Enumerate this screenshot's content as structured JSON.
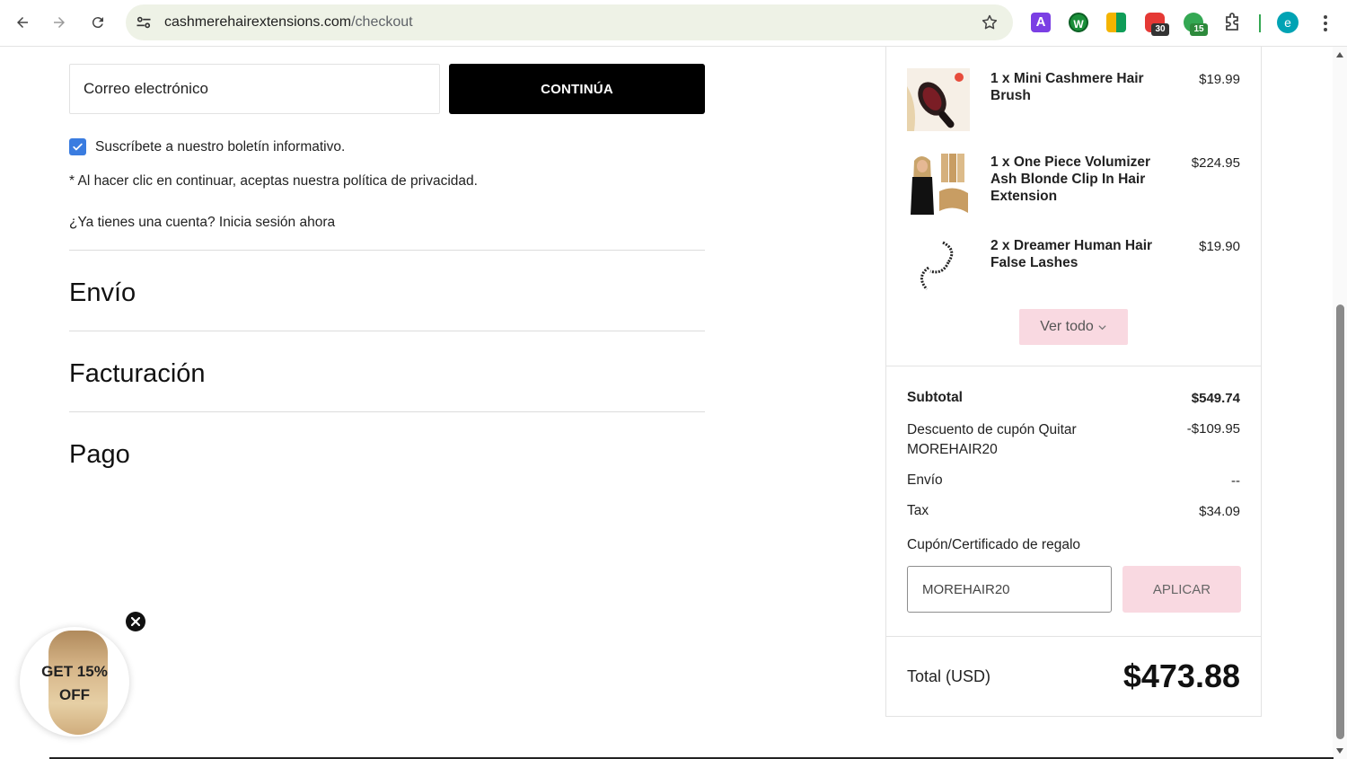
{
  "browser": {
    "url_domain": "cashmerehairextensions.com",
    "url_path": "/checkout",
    "extensions": [
      {
        "name": "text-a-extension-icon",
        "label": "A"
      },
      {
        "name": "w-extension-icon",
        "label": "W"
      },
      {
        "name": "grid-extension-icon",
        "label": ""
      },
      {
        "name": "red-extension-icon",
        "badge": "30"
      },
      {
        "name": "green-extension-icon",
        "badge": "15"
      }
    ],
    "profile_initial": "e"
  },
  "checkout": {
    "email_placeholder": "Correo electrónico",
    "continue_label": "CONTINÚA",
    "newsletter_label": "Suscríbete a nuestro boletín informativo.",
    "newsletter_checked": true,
    "privacy_note": "* Al hacer clic en continuar, aceptas nuestra política de privacidad.",
    "login_prompt": "¿Ya tienes una cuenta? Inicia sesión ahora",
    "sections": [
      "Envío",
      "Facturación",
      "Pago"
    ]
  },
  "promo": {
    "line1": "GET 15%",
    "line2": "OFF"
  },
  "order": {
    "items": [
      {
        "name": "1 x Mini Cashmere Hair Brush",
        "price": "$19.99",
        "thumb": "hair-brush-image"
      },
      {
        "name": "1 x One Piece Volumizer Ash Blonde Clip In Hair Extension",
        "price": "$224.95",
        "thumb": "hair-extension-image"
      },
      {
        "name": "2 x Dreamer Human Hair False Lashes",
        "price": "$19.90",
        "thumb": "false-lashes-image"
      }
    ],
    "see_all_label": "Ver todo",
    "subtotal_label": "Subtotal",
    "subtotal_value": "$549.74",
    "discount_label": "Descuento de cupón Quitar",
    "discount_code": "MOREHAIR20",
    "discount_value": "-$109.95",
    "shipping_label": "Envío",
    "shipping_value": "--",
    "tax_label": "Tax",
    "tax_value": "$34.09",
    "coupon_label": "Cupón/Certificado de regalo",
    "coupon_value": "MOREHAIR20",
    "apply_label": "APLICAR",
    "total_label": "Total (USD)",
    "total_value": "$473.88"
  },
  "colors": {
    "accent_pink": "#f9d9e1",
    "checkbox_blue": "#3a7ce0",
    "button_black": "#000000"
  }
}
